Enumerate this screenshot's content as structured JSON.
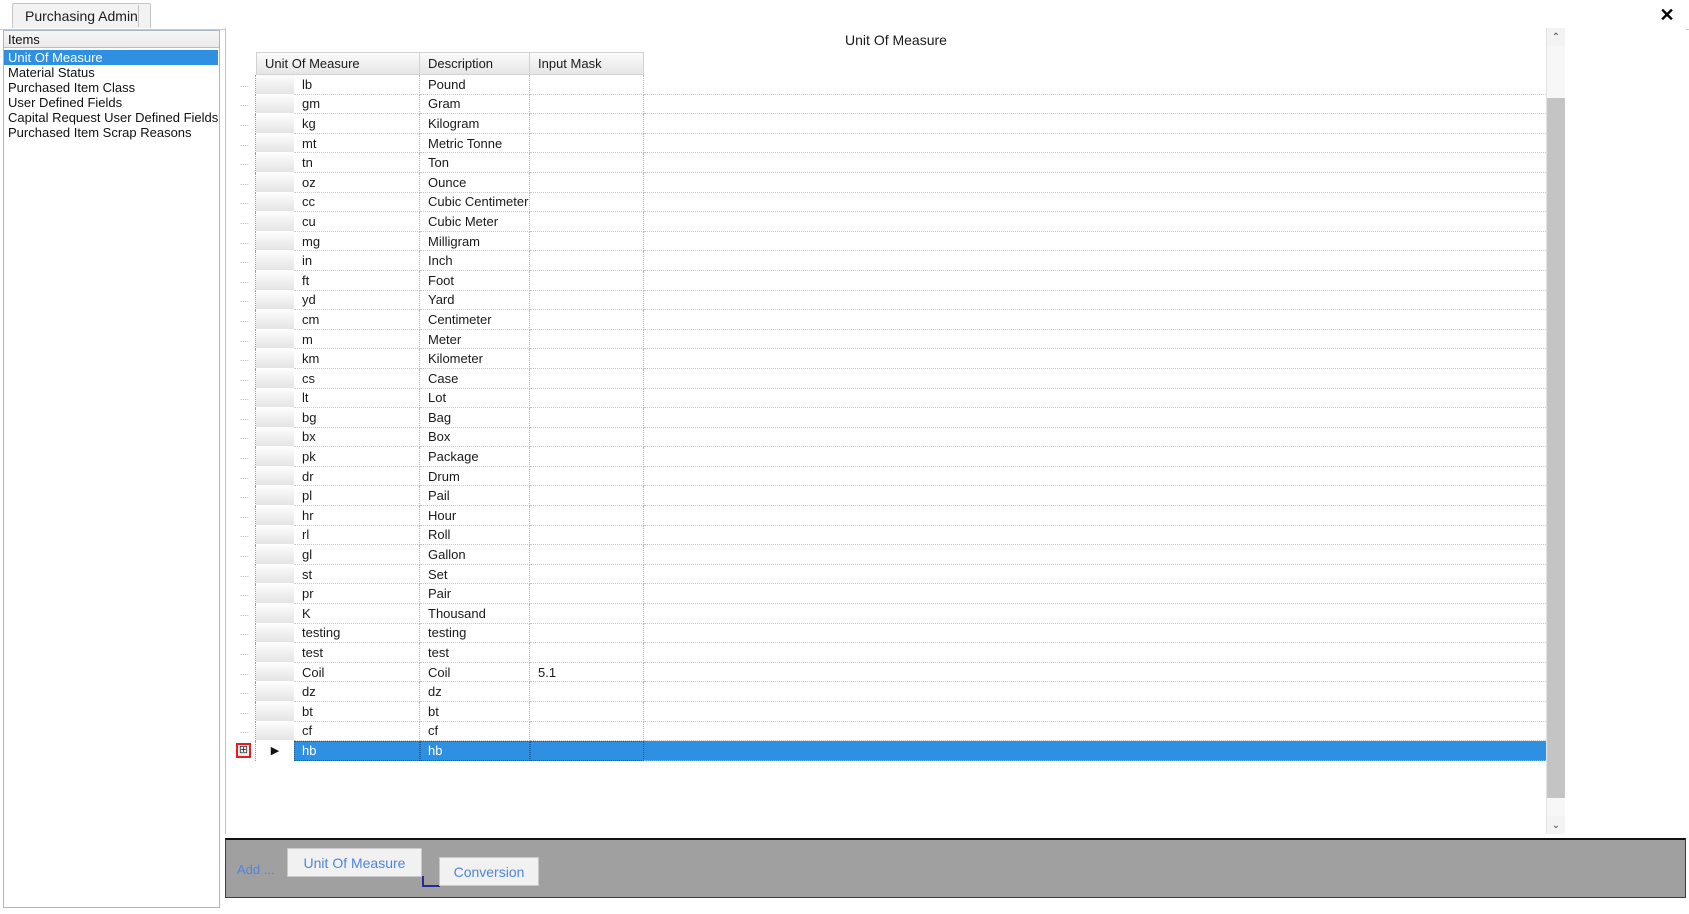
{
  "window": {
    "close_label": "✕"
  },
  "tabs": [
    {
      "label": "Purchasing Admin"
    }
  ],
  "sidebar": {
    "header": "Items",
    "items": [
      {
        "label": "Unit Of Measure",
        "selected": true
      },
      {
        "label": "Material Status",
        "selected": false
      },
      {
        "label": "Purchased Item Class",
        "selected": false
      },
      {
        "label": "User Defined Fields",
        "selected": false
      },
      {
        "label": "Capital Request User Defined Fields",
        "selected": false
      },
      {
        "label": "Purchased Item Scrap Reasons",
        "selected": false
      }
    ]
  },
  "main": {
    "title": "Unit Of Measure"
  },
  "grid": {
    "columns": [
      "Unit Of Measure",
      "Description",
      "Input Mask"
    ],
    "rows": [
      {
        "uom": "lb",
        "description": "Pound",
        "mask": "",
        "selected": false
      },
      {
        "uom": "gm",
        "description": "Gram",
        "mask": "",
        "selected": false
      },
      {
        "uom": "kg",
        "description": "Kilogram",
        "mask": "",
        "selected": false
      },
      {
        "uom": "mt",
        "description": "Metric Tonne",
        "mask": "",
        "selected": false
      },
      {
        "uom": "tn",
        "description": "Ton",
        "mask": "",
        "selected": false
      },
      {
        "uom": "oz",
        "description": "Ounce",
        "mask": "",
        "selected": false
      },
      {
        "uom": "cc",
        "description": "Cubic Centimeter",
        "mask": "",
        "selected": false
      },
      {
        "uom": "cu",
        "description": "Cubic Meter",
        "mask": "",
        "selected": false
      },
      {
        "uom": "mg",
        "description": "Milligram",
        "mask": "",
        "selected": false
      },
      {
        "uom": "in",
        "description": "Inch",
        "mask": "",
        "selected": false
      },
      {
        "uom": "ft",
        "description": "Foot",
        "mask": "",
        "selected": false
      },
      {
        "uom": "yd",
        "description": "Yard",
        "mask": "",
        "selected": false
      },
      {
        "uom": "cm",
        "description": "Centimeter",
        "mask": "",
        "selected": false
      },
      {
        "uom": "m",
        "description": "Meter",
        "mask": "",
        "selected": false
      },
      {
        "uom": "km",
        "description": "Kilometer",
        "mask": "",
        "selected": false
      },
      {
        "uom": "cs",
        "description": "Case",
        "mask": "",
        "selected": false
      },
      {
        "uom": "lt",
        "description": "Lot",
        "mask": "",
        "selected": false
      },
      {
        "uom": "bg",
        "description": "Bag",
        "mask": "",
        "selected": false
      },
      {
        "uom": "bx",
        "description": "Box",
        "mask": "",
        "selected": false
      },
      {
        "uom": "pk",
        "description": "Package",
        "mask": "",
        "selected": false
      },
      {
        "uom": "dr",
        "description": "Drum",
        "mask": "",
        "selected": false
      },
      {
        "uom": "pl",
        "description": "Pail",
        "mask": "",
        "selected": false
      },
      {
        "uom": "hr",
        "description": "Hour",
        "mask": "",
        "selected": false
      },
      {
        "uom": "rl",
        "description": "Roll",
        "mask": "",
        "selected": false
      },
      {
        "uom": "gl",
        "description": "Gallon",
        "mask": "",
        "selected": false
      },
      {
        "uom": "st",
        "description": "Set",
        "mask": "",
        "selected": false
      },
      {
        "uom": "pr",
        "description": "Pair",
        "mask": "",
        "selected": false
      },
      {
        "uom": "K",
        "description": "Thousand",
        "mask": "",
        "selected": false
      },
      {
        "uom": "testing",
        "description": "testing",
        "mask": "",
        "selected": false
      },
      {
        "uom": "test",
        "description": "test",
        "mask": "",
        "selected": false
      },
      {
        "uom": "Coil",
        "description": "Coil",
        "mask": "5.1",
        "selected": false
      },
      {
        "uom": "dz",
        "description": "dz",
        "mask": "",
        "selected": false
      },
      {
        "uom": "bt",
        "description": "bt",
        "mask": "",
        "selected": false
      },
      {
        "uom": "cf",
        "description": "cf",
        "mask": "",
        "selected": false
      },
      {
        "uom": "hb",
        "description": "hb",
        "mask": "",
        "selected": true
      }
    ],
    "expand_glyph": "⊞",
    "current_row_glyph": "▶"
  },
  "scrollbar": {
    "up_glyph": "⌃",
    "down_glyph": "⌄"
  },
  "toolbar": {
    "add_label": "Add ...",
    "unit_of_measure_label": "Unit Of Measure",
    "conversion_label": "Conversion"
  },
  "colors": {
    "selection_blue": "#2f8fe0",
    "toolbar_gray": "#a0a0a0",
    "link_blue": "#4f86d8",
    "expand_red": "#e02020"
  }
}
